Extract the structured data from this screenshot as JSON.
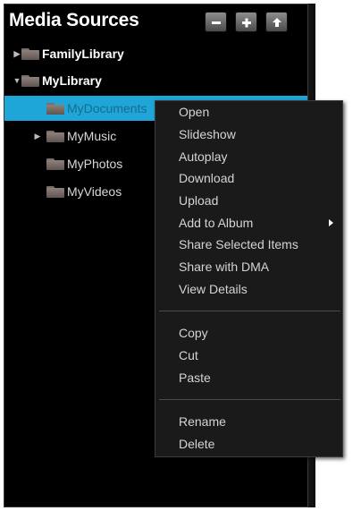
{
  "header": {
    "title": "Media Sources",
    "buttons": [
      {
        "icon": "minus-icon"
      },
      {
        "icon": "plus-icon"
      },
      {
        "icon": "up-arrow-icon"
      }
    ]
  },
  "tree": {
    "items": [
      {
        "label": "FamilyLibrary",
        "level": 0,
        "expanded": false
      },
      {
        "label": "MyLibrary",
        "level": 0,
        "expanded": true
      },
      {
        "label": "MyDocuments",
        "level": 1,
        "selected": true
      },
      {
        "label": "MyMusic",
        "level": 1,
        "expanded": false
      },
      {
        "label": "MyPhotos",
        "level": 1
      },
      {
        "label": "MyVideos",
        "level": 1
      }
    ]
  },
  "context_menu": {
    "items": [
      {
        "label": "Open"
      },
      {
        "label": "Slideshow"
      },
      {
        "label": "Autoplay"
      },
      {
        "label": "Download"
      },
      {
        "label": "Upload"
      },
      {
        "label": "Add to Album",
        "submenu": true
      },
      {
        "label": "Share Selected Items"
      },
      {
        "label": "Share with DMA"
      },
      {
        "label": "View Details"
      },
      {
        "label": "Copy"
      },
      {
        "label": "Cut"
      },
      {
        "label": "Paste"
      },
      {
        "label": "Rename"
      },
      {
        "label": "Delete"
      }
    ]
  },
  "colors": {
    "panel_bg": "#000000",
    "selection": "#1fa6d8",
    "menu_bg": "#1a1a1a",
    "menu_text": "#d4d4d4"
  }
}
